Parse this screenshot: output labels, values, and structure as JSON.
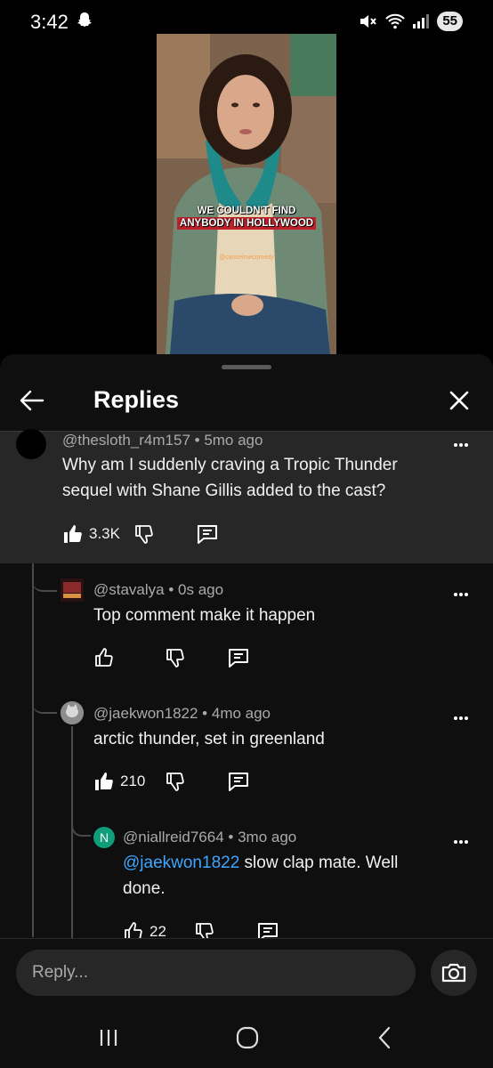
{
  "status_bar": {
    "time": "3:42",
    "battery": "55",
    "icons": [
      "snapchat-ghost-icon",
      "mute-icon",
      "wifi-icon",
      "signal-icon"
    ]
  },
  "video": {
    "caption_line1": "WE COULDN'T FIND",
    "caption_line2": "ANYBODY IN HOLLYWOOD",
    "watermark": "@cancelmecomedy"
  },
  "sheet": {
    "title": "Replies",
    "back_icon": "arrow-left-icon",
    "close_icon": "close-icon"
  },
  "comments": [
    {
      "author": "@thesloth_r4m157",
      "age": "5mo ago",
      "text": "Why am I suddenly craving a Tropic Thunder sequel with Shane Gillis added to the cast?",
      "likes": "3.3K",
      "liked": true
    },
    {
      "author": "@stavalya",
      "age": "0s ago",
      "text": "Top comment make it happen",
      "likes": "",
      "liked": false
    },
    {
      "author": "@jaekwon1822",
      "age": "4mo ago",
      "text": "arctic thunder, set in greenland",
      "likes": "210",
      "liked": true
    },
    {
      "author": "@niallreid7664",
      "age": "3mo ago",
      "avatar_letter": "N",
      "mention": "@jaekwon1822",
      "text": " slow clap mate. Well done.",
      "likes": "22",
      "liked": false
    }
  ],
  "reply": {
    "placeholder": "Reply..."
  },
  "colors": {
    "background": "#0f0f0f",
    "highlight": "#272727",
    "mention": "#3ea6ff",
    "avatar_n": "#0f9d7a"
  }
}
